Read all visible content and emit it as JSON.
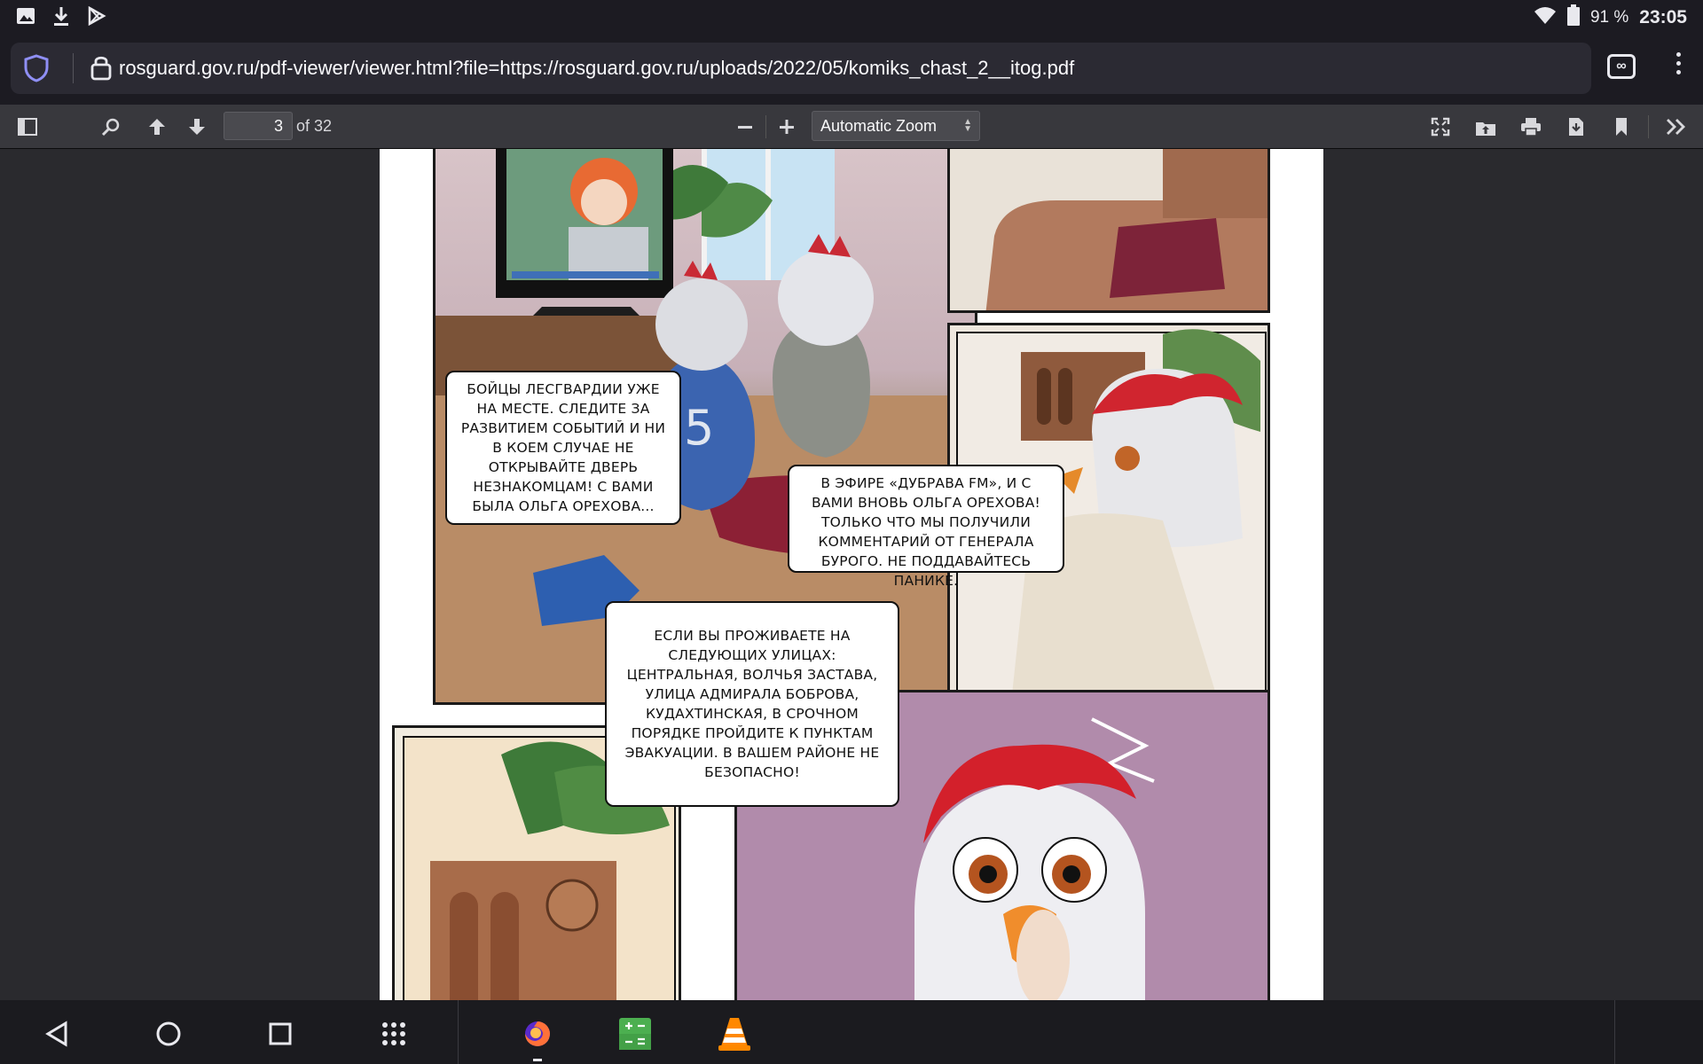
{
  "status_bar": {
    "icons_left": [
      "gallery-icon",
      "download-icon",
      "play-store-icon"
    ],
    "battery": "91 %",
    "time": "23:05"
  },
  "browser": {
    "url": "rosguard.gov.ru/pdf-viewer/viewer.html?file=https://rosguard.gov.ru/uploads/2022/05/komiks_chast_2__itog.pdf",
    "tabs_count": "∞"
  },
  "pdf_toolbar": {
    "page_number": "3",
    "page_total": "of 32",
    "zoom": "Automatic Zoom"
  },
  "comic": {
    "bubble_tv": "Бойцы Лесгвардии уже на месте. Следите за развитием событий и ни в коем случае не открывайте дверь незнакомцам! С вами была Ольга Орехова...",
    "bubble_radio": "В эфире «Дубрава FM», и с вами вновь Ольга Орехова! Только что мы получили комментарий от генерала Бурого. Не поддавайтесь панике.",
    "bubble_evac": "Если вы проживаете на следующих улицах: Центральная, Волчья застава, улица Адмирала Боброва, Кудахтинская, в срочном порядке пройдите к пунктам эвакуации. В вашем районе не безопасно!",
    "jersey_number": "5"
  },
  "nav_bar": {
    "apps": [
      "firefox-icon",
      "calculator-icon",
      "vlc-icon"
    ]
  },
  "colors": {
    "chrome_bg": "#1c1b22",
    "url_box": "#2b2a33",
    "toolbar": "#38383d",
    "viewer_bg": "#2a2a2e",
    "firefox_accent": "#ff7139",
    "vlc_orange": "#ff8800",
    "calc_green": "#4caf50"
  }
}
